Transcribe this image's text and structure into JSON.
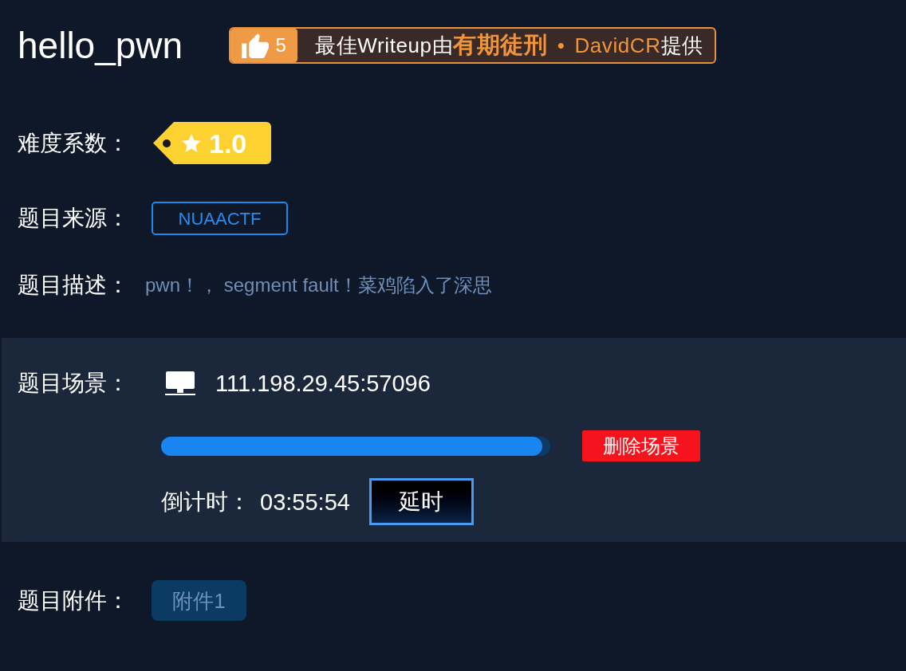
{
  "title": "hello_pwn",
  "writeup": {
    "likes": "5",
    "lead": "最佳Writeup由",
    "team": "有期徒刑",
    "separator": "•",
    "author": "DavidCR",
    "tail": "提供"
  },
  "fields": [
    {
      "kind": "difficulty",
      "label": "难度系数：",
      "value": "1.0"
    },
    {
      "kind": "tag",
      "label": "题目来源：",
      "value": "NUAACTF"
    },
    {
      "kind": "text",
      "label": "题目描述：",
      "value": "pwn！， segment fault！菜鸡陷入了深思"
    }
  ],
  "scene": {
    "label": "题目场景：",
    "address": "111.198.29.45:57096",
    "progress": {
      "level": 0.98
    },
    "delete_button": "删除场景",
    "countdown_label": "倒计时：",
    "countdown": "03:55:54",
    "extend_button": "延时"
  },
  "attachments": {
    "label": "题目附件：",
    "files": [
      "附件1"
    ]
  }
}
